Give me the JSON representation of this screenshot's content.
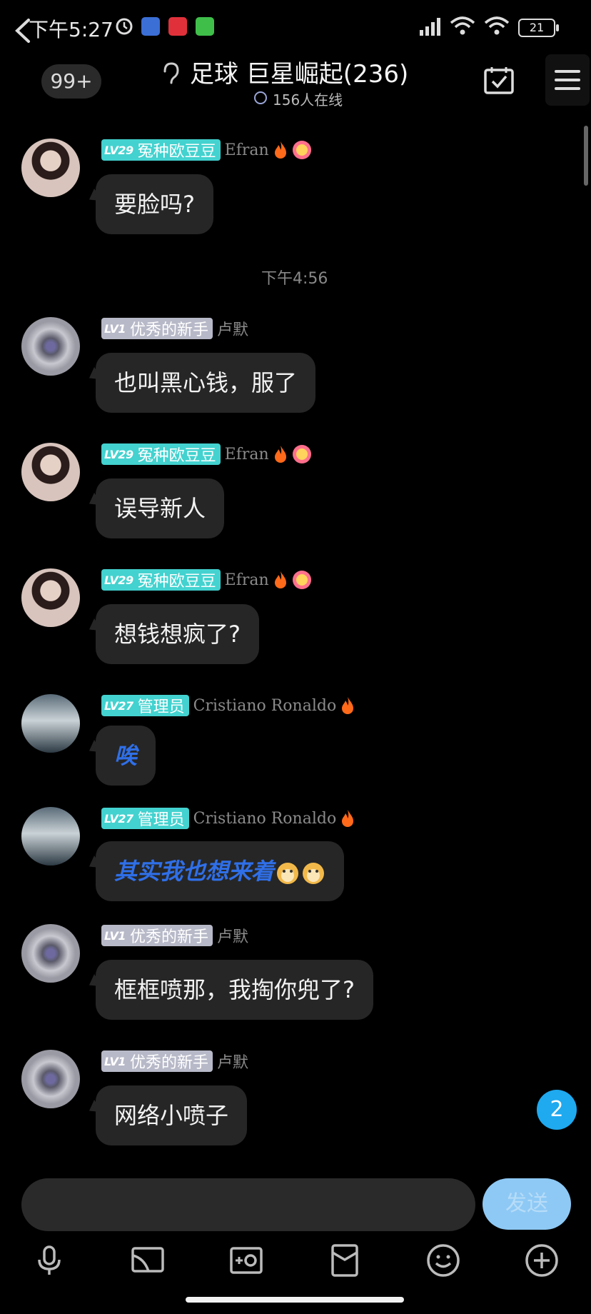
{
  "status_bar": {
    "time": "下午5:27",
    "battery": "21"
  },
  "header": {
    "unread_count": "99+",
    "title": "足球 巨星崛起(236)",
    "online": "156人在线"
  },
  "messages": [
    {
      "level": "LV29",
      "title": "冤种欧豆豆",
      "nick": "Efran",
      "text": "要脸吗?"
    },
    {
      "level": "LV1",
      "title": "优秀的新手",
      "nick": "卢默",
      "text": "也叫黑心钱，服了"
    },
    {
      "level": "LV29",
      "title": "冤种欧豆豆",
      "nick": "Efran",
      "text": "误导新人"
    },
    {
      "level": "LV29",
      "title": "冤种欧豆豆",
      "nick": "Efran",
      "text": "想钱想疯了?"
    },
    {
      "level": "LV27",
      "title": "管理员",
      "nick": "Cristiano Ronaldo",
      "text": "唉"
    },
    {
      "level": "LV27",
      "title": "管理员",
      "nick": "Cristiano Ronaldo",
      "text": "其实我也想来着"
    },
    {
      "level": "LV1",
      "title": "优秀的新手",
      "nick": "卢默",
      "text": "框框喷那，我掏你兜了?"
    },
    {
      "level": "LV1",
      "title": "优秀的新手",
      "nick": "卢默",
      "text": "网络小喷子"
    }
  ],
  "time_separator": "下午4:56",
  "new_message_count": "2",
  "input": {
    "value": "",
    "send_label": "发送"
  },
  "colors": {
    "teal_badge": "#43d2cf",
    "grey_badge": "#b7b9c8",
    "bubble": "#262626",
    "send": "#8ec9f5",
    "accent_blue": "#1fa9ef"
  }
}
